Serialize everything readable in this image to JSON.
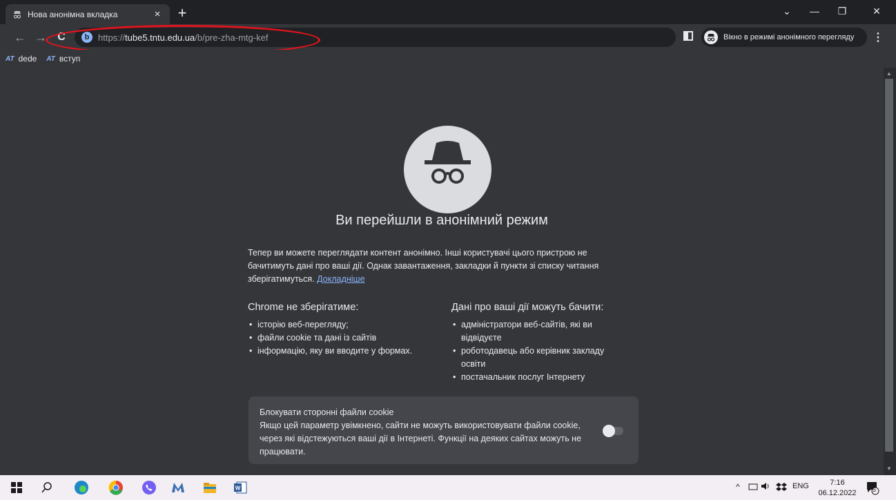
{
  "tab": {
    "title": "Нова анонімна вкладка",
    "close": "×"
  },
  "new_tab": "+",
  "window": {
    "minimize": "—",
    "restore": "❐",
    "close": "✕",
    "tab_search": "⌄"
  },
  "nav": {
    "back": "←",
    "forward": "→",
    "reload": "C"
  },
  "address": {
    "scheme": "https://",
    "host": "tube5.tntu.edu.ua",
    "path": "/b/pre-zha-mtg-kef",
    "site_letter": "b"
  },
  "incognito_chip": "Вікно в режимі анонімного перегляду",
  "menu": "⋮",
  "bookmarks": [
    {
      "icon": "AT",
      "label": "dede"
    },
    {
      "icon": "AT",
      "label": "вступ"
    }
  ],
  "page": {
    "heading": "Ви перейшли в анонімний режим",
    "intro": "Тепер ви можете переглядати контент анонімно. Інші користувачі цього пристрою не бачитимуть дані про ваші дії. Однак завантаження, закладки й пункти зі списку читання зберігатимуться.",
    "learn_more": "Докладніше",
    "left_title": "Chrome не зберігатиме:",
    "left_items": [
      "історію веб-перегляду;",
      "файли cookie та дані із сайтів",
      "інформацію, яку ви вводите у формах."
    ],
    "right_title": "Дані про ваші дії можуть бачити:",
    "right_items": [
      "адміністратори веб-сайтів, які ви відвідуєте",
      "роботодавець або керівник закладу освіти",
      "постачальник послуг Інтернету"
    ],
    "cookie_title": "Блокувати сторонні файли cookie",
    "cookie_desc": "Якщо цей параметр увімкнено, сайти не можуть використовувати файли cookie, через які відстежуються ваші дії в Інтернеті. Функції на деяких сайтах можуть не працювати.",
    "cookie_toggle_on": false
  },
  "taskbar": {
    "apps": [
      "windows-start-icon",
      "search-icon",
      "edge-icon",
      "chrome-icon",
      "viber-icon",
      "m-app-icon",
      "file-explorer-icon",
      "word-icon"
    ],
    "lang": "ENG",
    "time": "7:16",
    "date": "06.12.2022",
    "notifications": "5"
  },
  "colors": {
    "accent": "#8ab4f8",
    "annotation": "#e0141e",
    "bg": "#35363a"
  }
}
